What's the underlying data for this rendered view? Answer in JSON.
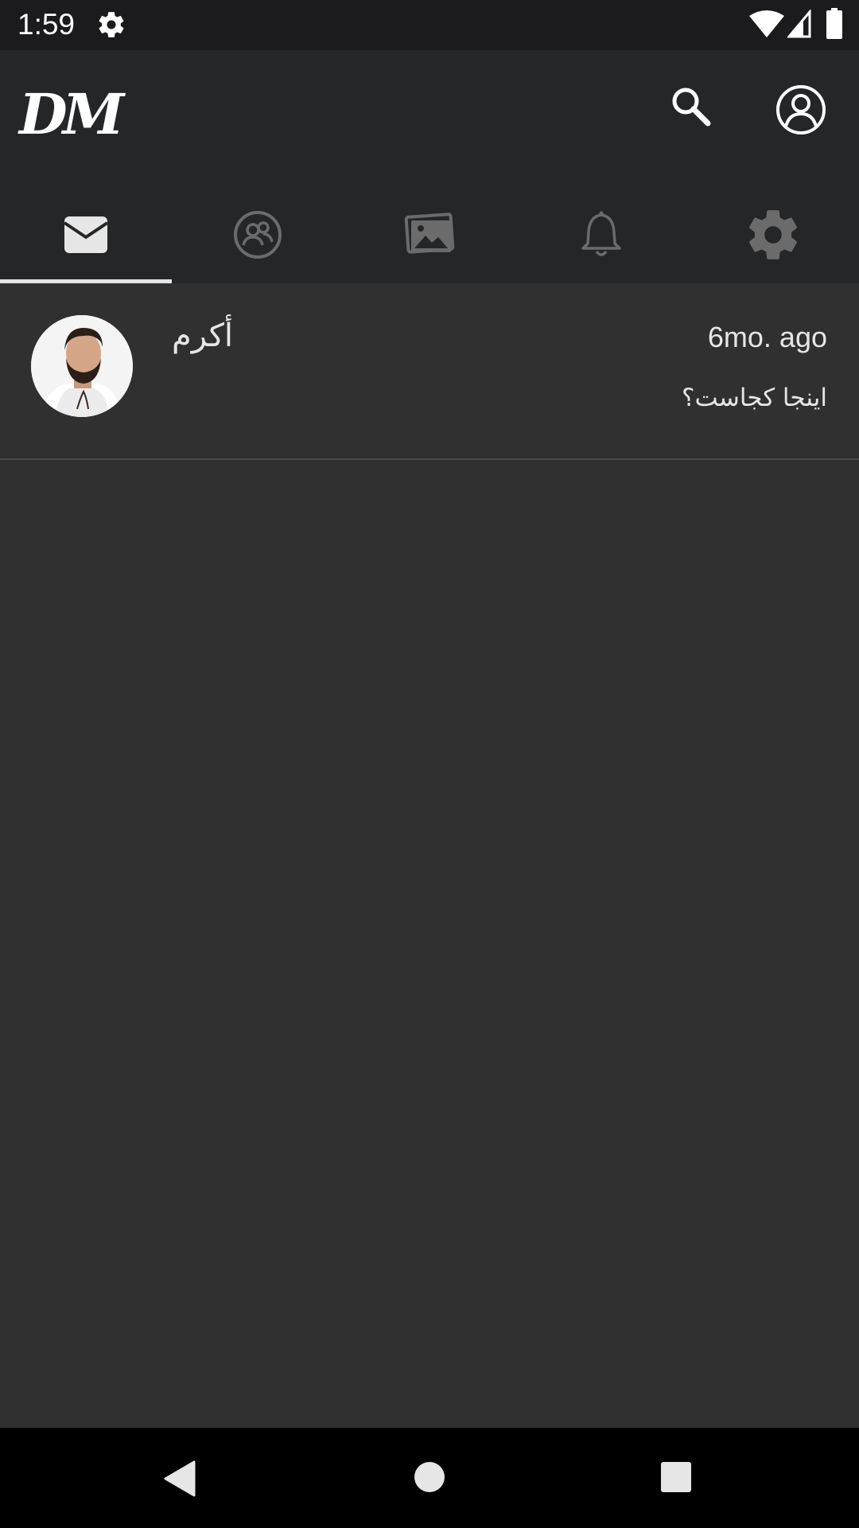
{
  "status_bar": {
    "time": "1:59",
    "icons": [
      "gear-icon",
      "wifi-icon",
      "signal-icon",
      "battery-icon"
    ]
  },
  "app_bar": {
    "logo_text": "DM",
    "actions": [
      "search-icon",
      "account-circle-icon"
    ]
  },
  "tabs": [
    {
      "icon": "envelope-icon",
      "selected": true
    },
    {
      "icon": "people-circle-icon",
      "selected": false
    },
    {
      "icon": "photos-icon",
      "selected": false
    },
    {
      "icon": "bell-icon",
      "selected": false
    },
    {
      "icon": "gear-icon",
      "selected": false
    }
  ],
  "conversations": [
    {
      "name": "أكرم",
      "time": "6mo. ago",
      "preview": "اینجا کجاست؟",
      "avatar": "avatar-photo"
    }
  ],
  "nav_bar": {
    "buttons": [
      "back-icon",
      "home-icon",
      "recents-icon"
    ]
  },
  "colors": {
    "status_bar_bg": "#1b1b1d",
    "app_bar_bg": "#252628",
    "content_bg": "#303030",
    "text": "#e6e6e6",
    "tab_active": "#e6e6e6",
    "tab_inactive": "#6b6b6b",
    "nav_bar_bg": "#000000"
  }
}
